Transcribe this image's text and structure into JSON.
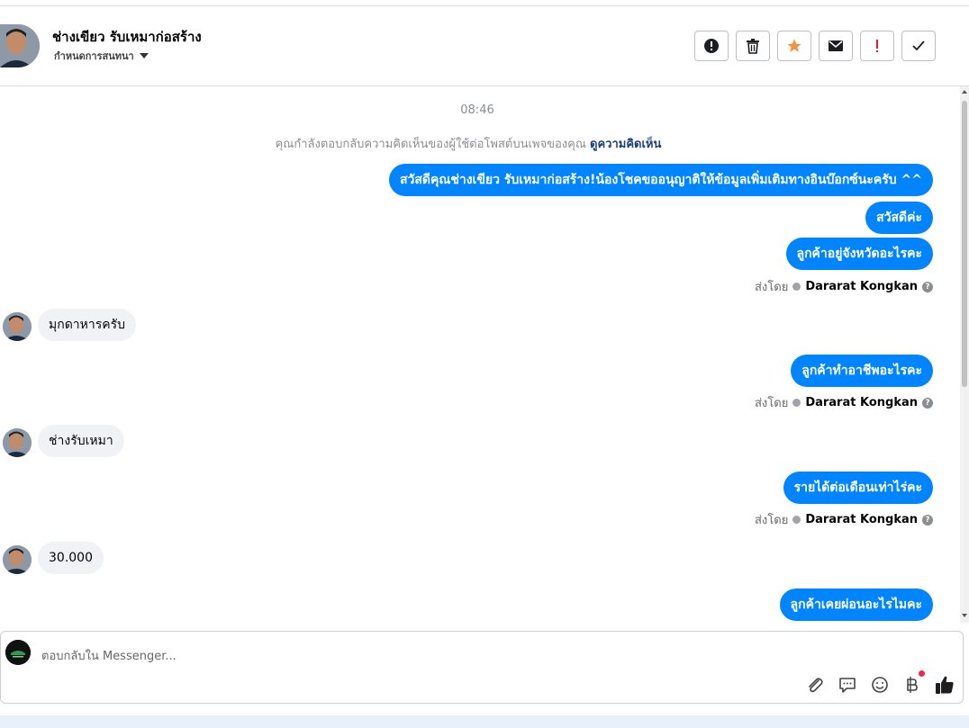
{
  "header": {
    "contact_name": "ช่างเขียว รับเหมาก่อสร้าง",
    "conversation_settings": "กำหนดการสนทนา",
    "actions": [
      {
        "name": "report-button",
        "icon": "exclamation-circle-icon"
      },
      {
        "name": "delete-button",
        "icon": "trash-icon"
      },
      {
        "name": "star-button",
        "icon": "star-icon",
        "color": "#f7923b"
      },
      {
        "name": "mark-unread-button",
        "icon": "envelope-icon"
      },
      {
        "name": "spam-button",
        "icon": "exclamation-icon",
        "color": "#e02020"
      },
      {
        "name": "done-button",
        "icon": "check-icon"
      }
    ]
  },
  "chat": {
    "timestamp": "08:46",
    "notice_text": "คุณกำลังตอบกลับความคิดเห็นของผู้ใช้ต่อโพสต์บนเพจของคุณ",
    "notice_link": "ดูความคิดเห็น",
    "messages": {
      "out_1": "สวัสดีคุณช่างเขียว รับเหมาก่อสร้าง!น้องโชคขออนุญาติให้ข้อมูลเพิ่มเติมทางอินบ๊อกซ์นะครับ ^^",
      "out_2": "สวัสดีค่ะ",
      "out_3": "ลูกค้าอยู่จังหวัดอะไรคะ",
      "in_1": "มุกดาหารครับ",
      "out_4": "ลูกค้าทำอาชีพอะไรคะ",
      "in_2": "ช่างรับเหมา",
      "out_5": "รายได้ต่อเดือนเท่าไร่คะ",
      "in_3": "30.000",
      "out_6": "ลูกค้าเคยผ่อนอะไรไมคะ"
    },
    "sent_by_label": "ส่งโดย",
    "sent_by_name": "Dararat Kongkan"
  },
  "composer": {
    "placeholder": "ตอบกลับใน Messenger...",
    "tools": [
      "paperclip-icon",
      "chat-bubble-icon",
      "smiley-icon",
      "baht-icon",
      "thumbs-up-icon"
    ],
    "accent": "#0084ff"
  }
}
